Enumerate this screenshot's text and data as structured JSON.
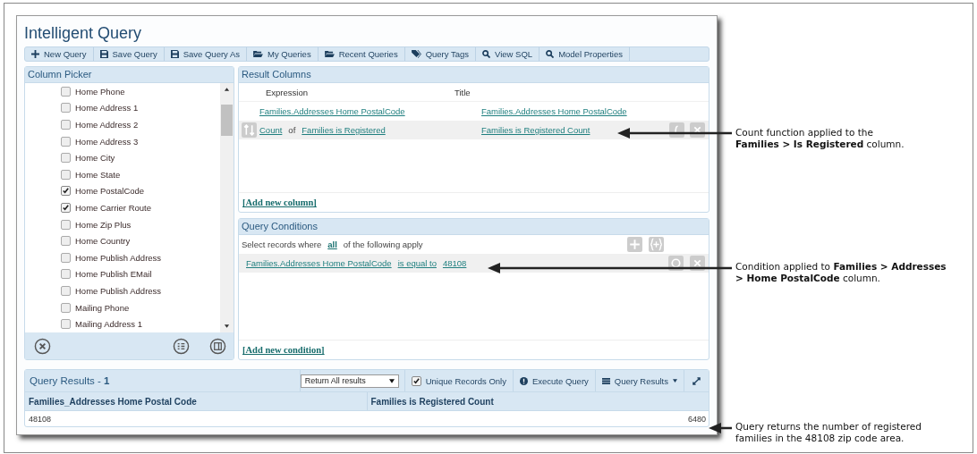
{
  "window": {
    "title": "Intelligent Query"
  },
  "toolbar": [
    {
      "kind": "plus",
      "label": "New Query"
    },
    {
      "kind": "save",
      "label": "Save Query"
    },
    {
      "kind": "save",
      "label": "Save Query As"
    },
    {
      "kind": "folder",
      "label": "My Queries"
    },
    {
      "kind": "folder",
      "label": "Recent Queries"
    },
    {
      "kind": "tag",
      "label": "Query Tags"
    },
    {
      "kind": "search",
      "label": "View SQL"
    },
    {
      "kind": "search",
      "label": "Model Properties"
    }
  ],
  "column_picker": {
    "title": "Column Picker",
    "items": [
      {
        "label": "Home Phone",
        "checked": false
      },
      {
        "label": "Home Address 1",
        "checked": false
      },
      {
        "label": "Home Address 2",
        "checked": false
      },
      {
        "label": "Home Address 3",
        "checked": false
      },
      {
        "label": "Home City",
        "checked": false
      },
      {
        "label": "Home State",
        "checked": false
      },
      {
        "label": "Home PostalCode",
        "checked": true
      },
      {
        "label": "Home Carrier Route",
        "checked": true
      },
      {
        "label": "Home Zip Plus",
        "checked": false
      },
      {
        "label": "Home Country",
        "checked": false
      },
      {
        "label": "Home Publish Address",
        "checked": false
      },
      {
        "label": "Home Publish EMail",
        "checked": false
      },
      {
        "label": "Home Publish Address",
        "checked": false
      },
      {
        "label": "Mailing Phone",
        "checked": false
      },
      {
        "label": "Mailing Address 1",
        "checked": false
      }
    ]
  },
  "result_columns": {
    "title": "Result Columns",
    "headers": [
      "Expression",
      "Title"
    ],
    "rows": [
      {
        "kind": "plain",
        "expression": "Families.Addresses Home PostalCode",
        "title": "Families.Addresses Home PostalCode",
        "selected": false
      },
      {
        "kind": "aggregate",
        "function": "Count",
        "connector": "of",
        "expression": "Families is Registered",
        "title": "Families is Registered Count",
        "selected": true
      }
    ],
    "add_link": "[Add new column]"
  },
  "query_conditions": {
    "title": "Query Conditions",
    "prefix": "Select records where",
    "quantifier": "all",
    "suffix": "of the following apply",
    "conditions": [
      {
        "field": "Families.Addresses Home PostalCode",
        "operator": "is equal to",
        "value": "48108",
        "selected": true
      }
    ],
    "add_link": "[Add new condition]"
  },
  "query_results": {
    "title": "Query Results - ",
    "count": "1",
    "return_mode": "Return All results",
    "unique": {
      "label": "Unique Records Only",
      "checked": true
    },
    "execute": "Execute Query",
    "results_menu": "Query Results",
    "columns": [
      "Families_Addresses Home Postal Code",
      "Families is Registered Count"
    ],
    "rows": [
      [
        "48108",
        "6480"
      ]
    ]
  },
  "annotations": [
    {
      "lines": [
        "Count function applied to the",
        "**Families > Is Registered** column."
      ]
    },
    {
      "lines": [
        "Condition applied to **Families > Addresses**",
        "**> Home PostalCode** column."
      ]
    },
    {
      "lines": [
        "Query returns the number of registered",
        "families in the 48108 zip code area."
      ]
    }
  ]
}
